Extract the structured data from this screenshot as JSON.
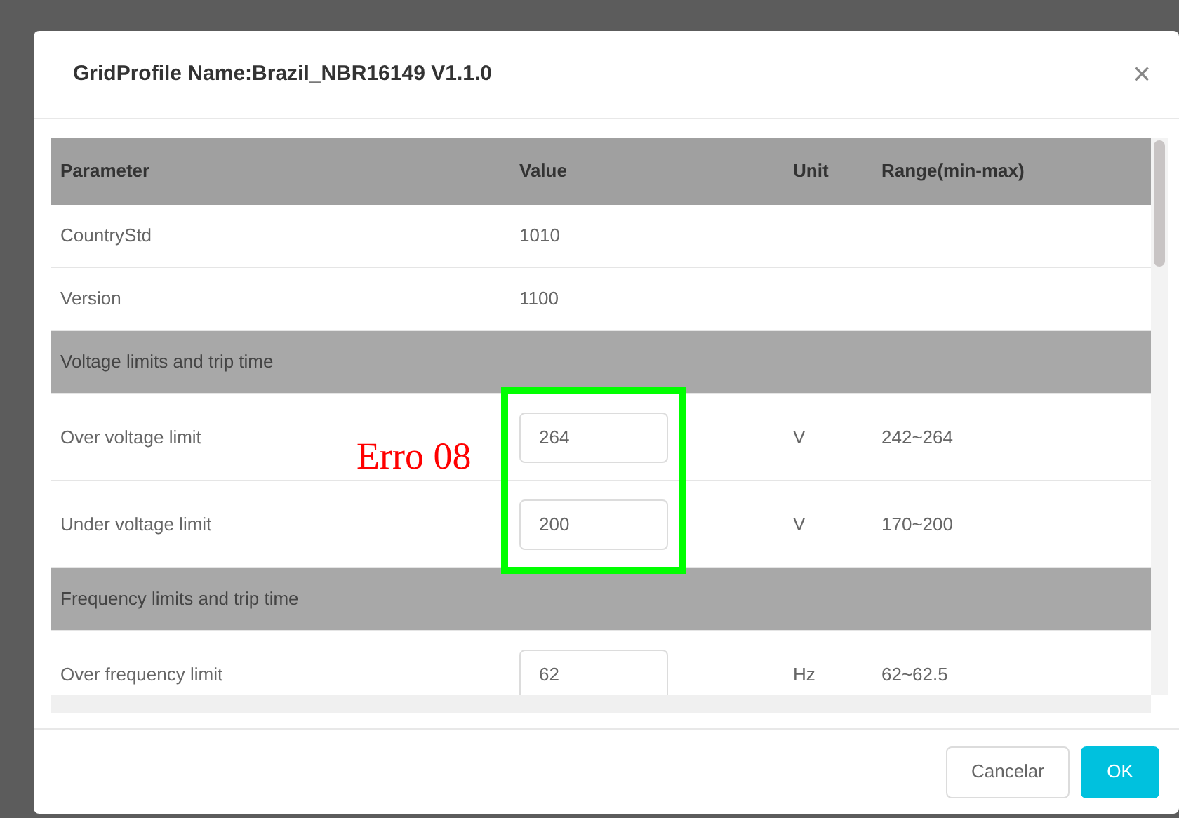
{
  "dialog": {
    "title": "GridProfile Name:Brazil_NBR16149 V1.1.0",
    "close": "×"
  },
  "table": {
    "columns": [
      "Parameter",
      "Value",
      "Unit",
      "Range(min-max)"
    ],
    "rows": [
      {
        "kind": "text",
        "parameter": "CountryStd",
        "value": "1010"
      },
      {
        "kind": "text",
        "parameter": "Version",
        "value": "1100"
      },
      {
        "kind": "section",
        "parameter": "Voltage limits and trip time"
      },
      {
        "kind": "input",
        "parameter": "Over voltage limit",
        "value": "264",
        "unit": "V",
        "range": "242~264"
      },
      {
        "kind": "input",
        "parameter": "Under voltage limit",
        "value": "200",
        "unit": "V",
        "range": "170~200"
      },
      {
        "kind": "section",
        "parameter": "Frequency limits and trip time"
      },
      {
        "kind": "input",
        "parameter": "Over frequency limit",
        "value": "62",
        "unit": "Hz",
        "range": "62~62.5"
      }
    ]
  },
  "annotation": {
    "text": "Erro 08"
  },
  "buttons": [
    "Cancelar",
    "OK"
  ]
}
